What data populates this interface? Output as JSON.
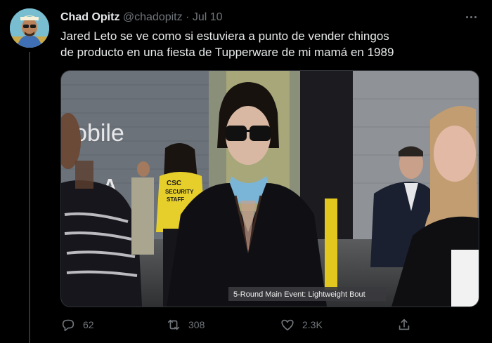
{
  "tweet": {
    "author_name": "Chad Opitz",
    "handle": "@chadopitz",
    "separator": "·",
    "date": "Jul 10",
    "text_line1": "Jared Leto se ve como si estuviera a punto de vender chingos",
    "text_line2": "de producto en una fiesta de Tupperware de mi mamá en 1989"
  },
  "media": {
    "wall_sign": "obile",
    "wall_letter": "A",
    "vest_line1": "CSC",
    "vest_line2": "SECURITY",
    "vest_line3": "STAFF",
    "lower_third": "5-Round Main Event: Lightweight Bout"
  },
  "actions": {
    "replies": "62",
    "retweets": "308",
    "likes": "2.3K"
  },
  "icons": {
    "reply": "reply-icon",
    "retweet": "retweet-icon",
    "like": "heart-icon",
    "share": "share-icon",
    "more": "more-icon"
  },
  "colors": {
    "background": "#000000",
    "primary_text": "#e7e9ea",
    "secondary_text": "#71767b"
  }
}
